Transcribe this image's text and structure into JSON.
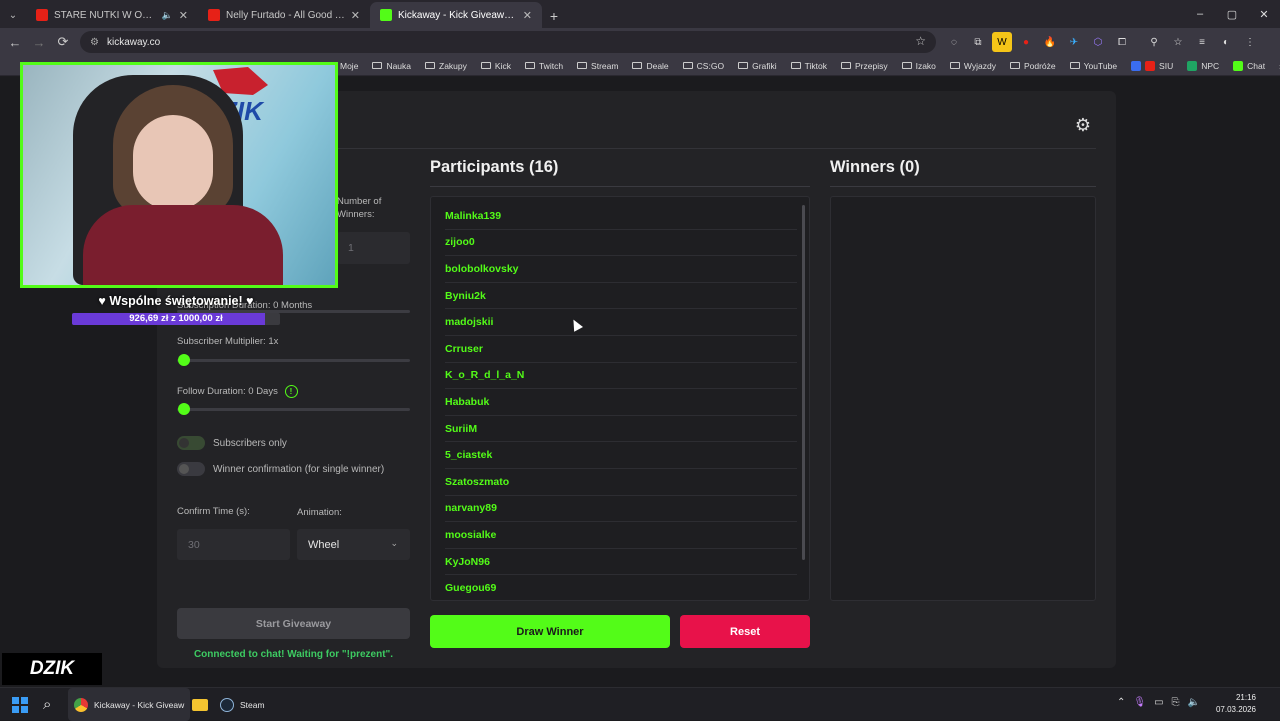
{
  "browser": {
    "tabs": [
      {
        "title": "STARE NUTKI W ODŚWIEŻ",
        "favicon_color": "#e62117",
        "extra": "🔈"
      },
      {
        "title": "Nelly Furtado - All Good Things",
        "favicon_color": "#e62117"
      },
      {
        "title": "Kickaway - Kick Giveaway Tool",
        "favicon_color": "#53fc18"
      }
    ],
    "tab_menu": "⌄",
    "new_tab": "+",
    "window_controls": [
      "–",
      "▢",
      "✕"
    ],
    "nav": {
      "back": "←",
      "forward": "→",
      "reload": "⟳"
    },
    "url": "kickaway.co",
    "bookmark_star": "☆",
    "extensions": [
      "◌",
      "⧉",
      "W",
      "●",
      "🔥",
      "✈",
      "⬡",
      "⧠",
      "⚲",
      "☆",
      "≡",
      "◐",
      "⋮"
    ],
    "bookmarks": [
      "Moje",
      "Nauka",
      "Zakupy",
      "Kick",
      "Twitch",
      "Stream",
      "Deale",
      "CS:GO",
      "Grafiki",
      "Tiktok",
      "Przepisy",
      "Izako",
      "Wyjazdy",
      "Podróże",
      "YouTube",
      "SIU",
      "NPC",
      "Chat"
    ],
    "bookmarks_more": "»"
  },
  "settings": {
    "number_of_winners_label": "Number of Winners:",
    "number_of_winners_value": "1",
    "subscription_duration_label": "Subscription Duration: 0 Months",
    "subscriber_multiplier_label": "Subscriber Multiplier: 1x",
    "follow_duration_label": "Follow Duration:  0  Days",
    "follow_info_icon": "!",
    "subscribers_only_label": "Subscribers only",
    "winner_confirmation_label": "Winner confirmation (for single winner)",
    "confirm_time_label": "Confirm Time (s):",
    "confirm_time_placeholder": "30",
    "animation_label": "Animation:",
    "animation_value": "Wheel",
    "start_button": "Start Giveaway",
    "status_text": "Connected to chat! Waiting for \"!prezent\"."
  },
  "participants": {
    "title": "Participants (16)",
    "items": [
      "Malinka139",
      "zijoo0",
      "bolobolkovsky",
      "Byniu2k",
      "madojskii",
      "Crruser",
      "K_o_R_d_l_a_N",
      "Hababuk",
      "SuriiM",
      "5_ciastek",
      "Szatoszmato",
      "narvany89",
      "moosialke",
      "KyJoN96",
      "Guegou69"
    ]
  },
  "winners": {
    "title": "Winners (0)"
  },
  "actions": {
    "draw": "Draw Winner",
    "reset": "Reset"
  },
  "overlay": {
    "goal_text": "♥ Wspólne świętowanie! ♥",
    "goal_progress": "926,69 zł  z  1000,00 zł",
    "goal_fraction": 0.9267,
    "logo_text": "DZIK"
  },
  "taskbar": {
    "active_window": "Kickaway - Kick Giveaw",
    "steam": "Steam",
    "time": "21:16",
    "date": "07.03.2026"
  },
  "colors": {
    "accent": "#53fc18",
    "danger": "#e8124a"
  }
}
